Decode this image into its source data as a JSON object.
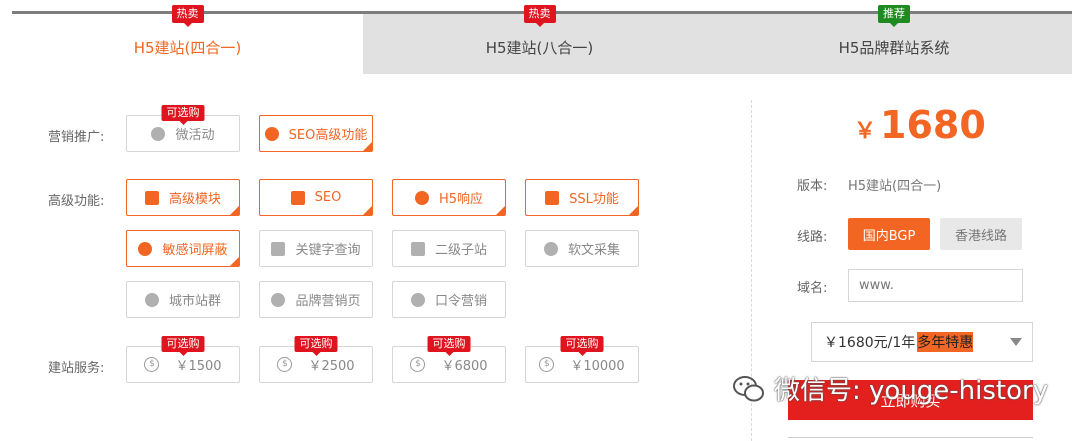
{
  "tabs": [
    {
      "label": "H5建站(四合一)",
      "badge": "热卖",
      "badge_color": "#e0141e",
      "active": true
    },
    {
      "label": "H5建站(八合一)",
      "badge": "热卖",
      "badge_color": "#e0141e",
      "active": false
    },
    {
      "label": "H5品牌群站系统",
      "badge": "推荐",
      "badge_color": "#1f8a1f",
      "active": false
    }
  ],
  "rows": {
    "marketing": "营销推广:",
    "advanced": "高级功能:",
    "service": "建站服务:"
  },
  "marketing_options": [
    {
      "label": "微活动",
      "badge": "可选购",
      "icon": "camera-aperture-icon",
      "selected": false
    },
    {
      "label": "SEO高级功能",
      "icon": "camera-aperture-icon",
      "selected": true
    }
  ],
  "advanced_options": [
    {
      "label": "高级模块",
      "icon": "crown-icon",
      "selected": true
    },
    {
      "label": "SEO",
      "icon": "bar-chart-icon",
      "selected": true
    },
    {
      "label": "H5响应",
      "icon": "globe-icon",
      "selected": true
    },
    {
      "label": "SSL功能",
      "icon": "certificate-icon",
      "selected": true
    },
    {
      "label": "敏感词屏蔽",
      "icon": "filter-icon",
      "selected": true
    },
    {
      "label": "关键字查询",
      "icon": "bar-chart-icon",
      "selected": false
    },
    {
      "label": "二级子站",
      "icon": "sub-site-icon",
      "selected": false
    },
    {
      "label": "软文采集",
      "icon": "globe-icon",
      "selected": false
    },
    {
      "label": "城市站群",
      "icon": "globe-icon",
      "selected": false
    },
    {
      "label": "品牌营销页",
      "icon": "globe-icon",
      "selected": false
    },
    {
      "label": "口令营销",
      "icon": "globe-icon",
      "selected": false
    }
  ],
  "service_options": [
    {
      "label": "￥1500",
      "badge": "可选购",
      "icon": "coin-icon"
    },
    {
      "label": "￥2500",
      "badge": "可选购",
      "icon": "coin-icon"
    },
    {
      "label": "￥6800",
      "badge": "可选购",
      "icon": "coin-icon"
    },
    {
      "label": "￥10000",
      "badge": "可选购",
      "icon": "coin-icon"
    }
  ],
  "sidebar": {
    "price_currency": "￥",
    "price": "1680",
    "version_label": "版本:",
    "version_value": "H5建站(四合一)",
    "line_label": "线路:",
    "line_active": "国内BGP",
    "line_inactive": "香港线路",
    "domain_label": "域名:",
    "domain_placeholder": "www.",
    "period_main": "￥1680元/1年",
    "period_highlight": "多年特惠",
    "buy_label": "立即购买"
  },
  "watermark": "微信号: youge-history",
  "colors": {
    "accent": "#f26522",
    "badge_red": "#e0141e",
    "badge_green": "#1f8a1f",
    "buy": "#e3201e"
  }
}
